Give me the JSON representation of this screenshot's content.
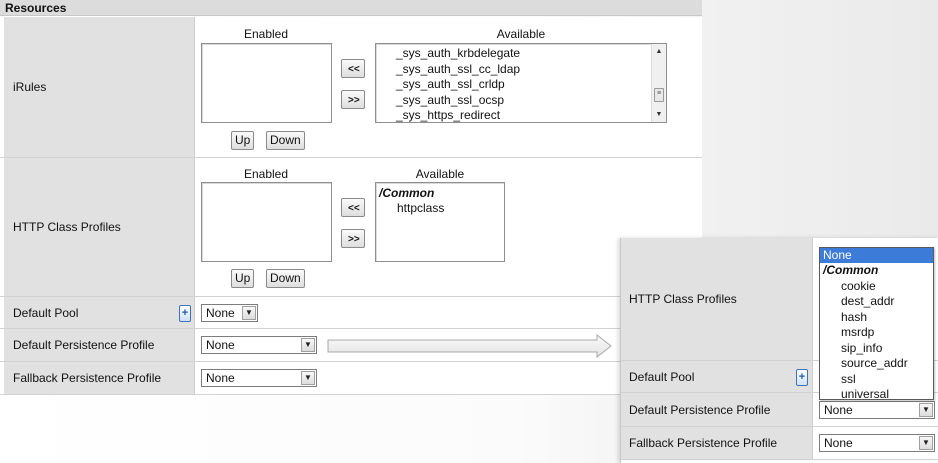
{
  "section_title": "Resources",
  "irules": {
    "label": "iRules",
    "enabled_header": "Enabled",
    "available_header": "Available",
    "available_items": [
      "_sys_auth_krbdelegate",
      "_sys_auth_ssl_cc_ldap",
      "_sys_auth_ssl_crldp",
      "_sys_auth_ssl_ocsp",
      "_sys_https_redirect"
    ],
    "move_left_label": "<<",
    "move_right_label": ">>",
    "up_label": "Up",
    "down_label": "Down"
  },
  "http_class": {
    "label": "HTTP Class Profiles",
    "enabled_header": "Enabled",
    "available_header": "Available",
    "group_label": "/Common",
    "available_items": [
      "httpclass"
    ],
    "move_left_label": "<<",
    "move_right_label": ">>",
    "up_label": "Up",
    "down_label": "Down"
  },
  "default_pool": {
    "label": "Default Pool",
    "add_label": "+",
    "value": "None"
  },
  "default_persistence": {
    "label": "Default Persistence Profile",
    "value": "None"
  },
  "fallback_persistence": {
    "label": "Fallback Persistence Profile",
    "value": "None"
  },
  "zoom": {
    "http_class_label": "HTTP Class Profiles",
    "default_pool_label": "Default Pool",
    "default_pool_add": "+",
    "default_persistence_label": "Default Persistence Profile",
    "default_persistence_value": "None",
    "fallback_persistence_label": "Fallback Persistence Profile",
    "fallback_persistence_value": "None",
    "dropdown": {
      "selected": "None",
      "group": "/Common",
      "options": [
        "cookie",
        "dest_addr",
        "hash",
        "msrdp",
        "sip_info",
        "source_addr",
        "ssl",
        "universal"
      ]
    }
  },
  "colors": {
    "label_bg": "#e1e1e1",
    "selected_bg": "#3d7bd9",
    "plus_blue": "#1e5aa8"
  }
}
